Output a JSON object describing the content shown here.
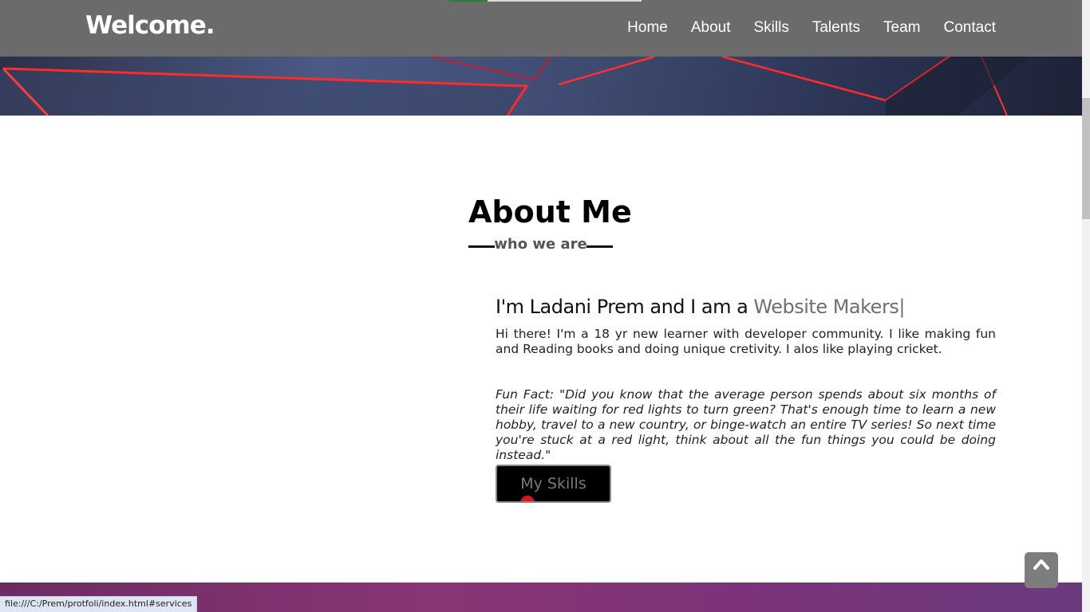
{
  "navbar": {
    "brand": "Welcome.",
    "links": [
      "Home",
      "About",
      "Skills",
      "Talents",
      "Team",
      "Contact"
    ]
  },
  "about": {
    "title": "About Me",
    "subtitle": "who we are",
    "intro_prefix": "I'm Ladani Prem and I am a ",
    "intro_role": "Website Makers",
    "intro_cursor": "|",
    "bio": "Hi there! I'm a 18 yr new learner with developer community. I like making fun and Reading books and doing unique cretivity. I alos like playing cricket.",
    "fun_fact": "Fun Fact: \"Did you know that the average person spends about six months of their life waiting for red lights to turn green? That's enough time to learn a new hobby, travel to a new country, or binge-watch an entire TV series! So next time you're stuck at a red light, think about all the fun things you could be doing instead.\"",
    "button_label": "My Skills"
  },
  "back_to_top": {
    "icon": "chevron-up-icon"
  },
  "status_bar": {
    "url": "file:///C:/Prem/protfoli/index.html#services"
  },
  "colors": {
    "navbar": "#6b6b6b",
    "accent_red": "#e1141b",
    "role_text": "#6f6f6f",
    "progress_green": "#2e7d3a"
  }
}
